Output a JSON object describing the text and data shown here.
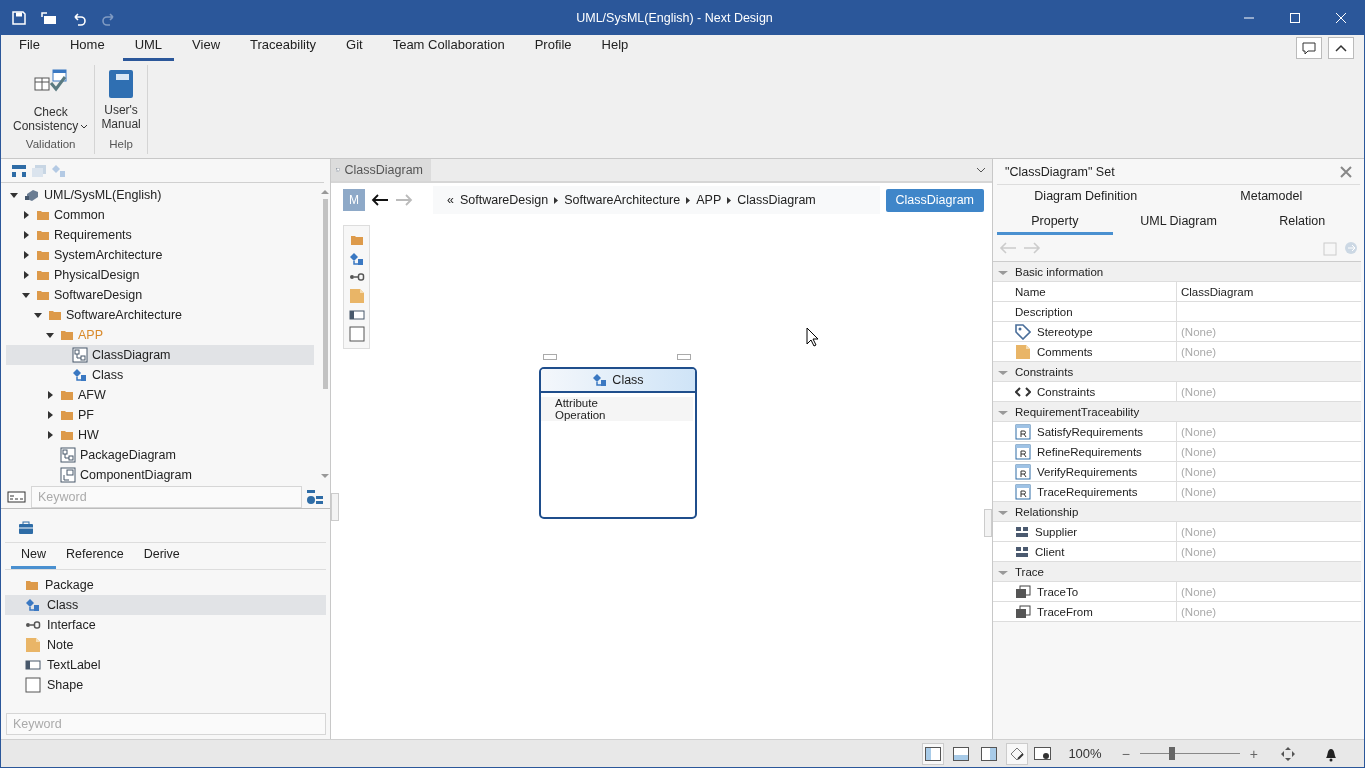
{
  "window": {
    "title": "UML/SysML(English) - Next Design"
  },
  "menu_tabs": [
    {
      "label": "File",
      "selected": false
    },
    {
      "label": "Home",
      "selected": false
    },
    {
      "label": "UML",
      "selected": true
    },
    {
      "label": "View",
      "selected": false
    },
    {
      "label": "Traceability",
      "selected": false
    },
    {
      "label": "Git",
      "selected": false
    },
    {
      "label": "Team Collaboration",
      "selected": false
    },
    {
      "label": "Profile",
      "selected": false
    },
    {
      "label": "Help",
      "selected": false
    }
  ],
  "ribbon_groups": [
    {
      "caption": "Validation",
      "button": {
        "kind": "check",
        "lines": [
          "Check",
          "Consistency"
        ],
        "dropdown": true
      }
    },
    {
      "caption": "Help",
      "button": {
        "kind": "manual",
        "lines": [
          "User's",
          "Manual"
        ],
        "dropdown": false
      }
    }
  ],
  "tree": [
    {
      "label": "UML/SysML(English)",
      "kind": "model",
      "expanded": true,
      "selected": false,
      "highlighted": false,
      "children": [
        {
          "label": "Common",
          "kind": "folder",
          "expanded": false,
          "selected": false,
          "highlighted": false
        },
        {
          "label": "Requirements",
          "kind": "folder",
          "expanded": false,
          "selected": false,
          "highlighted": false
        },
        {
          "label": "SystemArchitecture",
          "kind": "folder",
          "expanded": false,
          "selected": false,
          "highlighted": false
        },
        {
          "label": "PhysicalDesign",
          "kind": "folder",
          "expanded": false,
          "selected": false,
          "highlighted": false
        },
        {
          "label": "SoftwareDesign",
          "kind": "folder",
          "expanded": true,
          "selected": false,
          "highlighted": false,
          "children": [
            {
              "label": "SoftwareArchitecture",
              "kind": "folder",
              "expanded": true,
              "selected": false,
              "highlighted": false,
              "children": [
                {
                  "label": "APP",
                  "kind": "folder",
                  "expanded": true,
                  "selected": false,
                  "highlighted": true,
                  "children": [
                    {
                      "label": "ClassDiagram",
                      "kind": "diagram",
                      "selected": true,
                      "highlighted": false
                    },
                    {
                      "label": "Class",
                      "kind": "class",
                      "selected": false,
                      "highlighted": false
                    }
                  ]
                },
                {
                  "label": "AFW",
                  "kind": "folder",
                  "expanded": false,
                  "selected": false,
                  "highlighted": false
                },
                {
                  "label": "PF",
                  "kind": "folder",
                  "expanded": false,
                  "selected": false,
                  "highlighted": false
                },
                {
                  "label": "HW",
                  "kind": "folder",
                  "expanded": false,
                  "selected": false,
                  "highlighted": false
                },
                {
                  "label": "PackageDiagram",
                  "kind": "diagram",
                  "selected": false,
                  "highlighted": false
                },
                {
                  "label": "ComponentDiagram",
                  "kind": "component",
                  "selected": false,
                  "highlighted": false
                }
              ]
            }
          ]
        }
      ]
    }
  ],
  "tree_search": {
    "placeholder": "Keyword"
  },
  "toolbox_tabs": [
    {
      "label": "New",
      "selected": true
    },
    {
      "label": "Reference",
      "selected": false
    },
    {
      "label": "Derive",
      "selected": false
    }
  ],
  "toolbox_items": [
    {
      "label": "Package",
      "kind": "folder",
      "selected": false
    },
    {
      "label": "Class",
      "kind": "class",
      "selected": true
    },
    {
      "label": "Interface",
      "kind": "interface",
      "selected": false
    },
    {
      "label": "Note",
      "kind": "note",
      "selected": false
    },
    {
      "label": "TextLabel",
      "kind": "textlabel",
      "selected": false
    },
    {
      "label": "Shape",
      "kind": "shape",
      "selected": false
    }
  ],
  "toolbox_search": {
    "placeholder": "Keyword"
  },
  "document_tab": {
    "label": "ClassDiagram"
  },
  "model_badge": "M",
  "breadcrumb": {
    "prefix": "«",
    "items": [
      "SoftwareDesign",
      "SoftwareArchitecture",
      "APP",
      "ClassDiagram"
    ]
  },
  "diagram_button": "ClassDiagram",
  "palette": [
    {
      "kind": "folder"
    },
    {
      "kind": "class"
    },
    {
      "kind": "interface"
    },
    {
      "kind": "note"
    },
    {
      "kind": "textlabel"
    },
    {
      "kind": "shape"
    }
  ],
  "class_node": {
    "title": "Class",
    "compartments": [
      "Attribute",
      "Operation"
    ]
  },
  "properties": {
    "title": "\"ClassDiagram\" Set",
    "tab_rows": [
      [
        {
          "label": "Diagram Definition",
          "selected": false
        },
        {
          "label": "Metamodel",
          "selected": false
        }
      ],
      [
        {
          "label": "Property",
          "selected": true
        },
        {
          "label": "UML Diagram",
          "selected": false
        },
        {
          "label": "Relation",
          "selected": false
        }
      ]
    ],
    "sections": [
      {
        "title": "Basic information",
        "expanded": true,
        "rows": [
          {
            "name": "Name",
            "kind": "plain",
            "value": "ClassDiagram",
            "unset": false
          },
          {
            "name": "Description",
            "kind": "plain"
          },
          {
            "name": "Stereotype",
            "kind": "tag",
            "value": "(None)",
            "unset": true
          },
          {
            "name": "Comments",
            "kind": "note",
            "value": "(None)",
            "unset": true
          }
        ]
      },
      {
        "title": "Constraints",
        "expanded": true,
        "rows": [
          {
            "name": "Constraints",
            "kind": "code",
            "value": "(None)",
            "unset": true
          }
        ]
      },
      {
        "title": "RequirementTraceability",
        "expanded": true,
        "rows": [
          {
            "name": "SatisfyRequirements",
            "kind": "req",
            "value": "(None)",
            "unset": true
          },
          {
            "name": "RefineRequirements",
            "kind": "req",
            "value": "(None)",
            "unset": true
          },
          {
            "name": "VerifyRequirements",
            "kind": "req",
            "value": "(None)",
            "unset": true
          },
          {
            "name": "TraceRequirements",
            "kind": "req",
            "value": "(None)",
            "unset": true
          }
        ]
      },
      {
        "title": "Relationship",
        "expanded": true,
        "rows": [
          {
            "name": "Supplier",
            "kind": "blocks",
            "value": "(None)",
            "unset": true
          },
          {
            "name": "Client",
            "kind": "blocks",
            "value": "(None)",
            "unset": true
          }
        ]
      },
      {
        "title": "Trace",
        "expanded": true,
        "rows": [
          {
            "name": "TraceTo",
            "kind": "stack",
            "value": "(None)",
            "unset": true
          },
          {
            "name": "TraceFrom",
            "kind": "stack",
            "value": "(None)",
            "unset": true
          }
        ]
      }
    ]
  },
  "status_bar": {
    "layouts": [
      {
        "kind": "left",
        "pressed": true
      },
      {
        "kind": "bottom",
        "pressed": false
      },
      {
        "kind": "right",
        "pressed": false
      },
      {
        "kind": "sketch",
        "pressed": true
      }
    ],
    "zoom": "100%",
    "zoom_minus": "−",
    "zoom_plus": "+",
    "zoom_slider": {
      "level": 0.32
    }
  }
}
